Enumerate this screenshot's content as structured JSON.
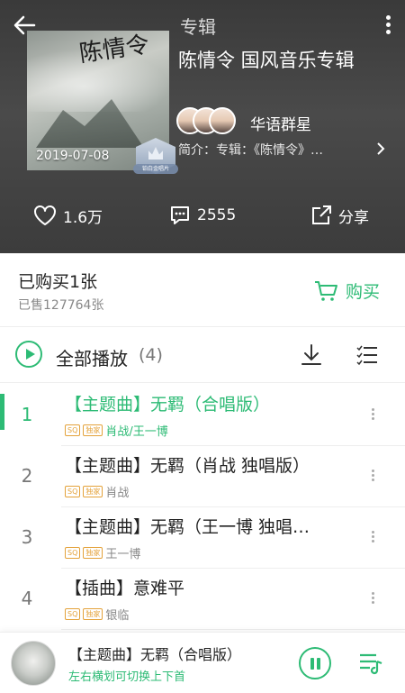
{
  "header": {
    "title": "专辑",
    "album_name": "陈情令  国风音乐专辑",
    "release_date": "2019-07-08",
    "cover_art_text": "陈情令",
    "badge_text": "铂白金唱片",
    "artist": "华语群星",
    "intro": "简介：专辑：《陈情令》…",
    "stats": {
      "likes": "1.6万",
      "comments": "2555",
      "share": "分享"
    }
  },
  "purchase": {
    "bought": "已购买1张",
    "sold": "已售127764张",
    "buy_label": "购买"
  },
  "playall": {
    "label": "全部播放",
    "count": "(4)"
  },
  "tracks": [
    {
      "num": "1",
      "name": "【主题曲】无羁（合唱版）",
      "sq": "SQ",
      "exclusive": "独家",
      "artist": "肖战/王一博",
      "active": true
    },
    {
      "num": "2",
      "name": "【主题曲】无羁（肖战 独唱版）",
      "sq": "SQ",
      "exclusive": "独家",
      "artist": "肖战",
      "active": false
    },
    {
      "num": "3",
      "name": "【主题曲】无羁（王一博 独唱…",
      "sq": "SQ",
      "exclusive": "独家",
      "artist": "王一博",
      "active": false
    },
    {
      "num": "4",
      "name": "【插曲】意难平",
      "sq": "SQ",
      "exclusive": "独家",
      "artist": "银临",
      "active": false
    }
  ],
  "player": {
    "title": "【主题曲】无羁（合唱版）",
    "hint": "左右横划可切换上下首"
  },
  "colors": {
    "accent": "#2dbb75",
    "header_bg": "#3f3f3f"
  },
  "icons": [
    "back-arrow-icon",
    "more-vertical-icon",
    "heart-icon",
    "comment-icon",
    "share-icon",
    "cart-icon",
    "play-circle-icon",
    "download-icon",
    "list-select-icon",
    "pause-icon",
    "playlist-icon"
  ]
}
